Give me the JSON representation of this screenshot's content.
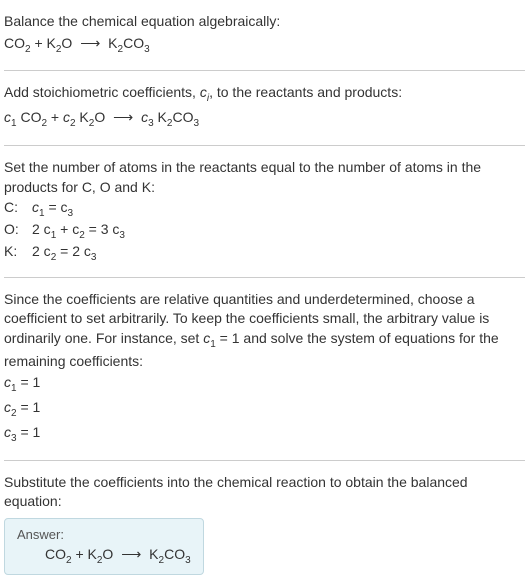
{
  "chart_data": {
    "type": "table",
    "reactants": [
      {
        "formula": "CO2",
        "coefficient": 1
      },
      {
        "formula": "K2O",
        "coefficient": 1
      }
    ],
    "products": [
      {
        "formula": "K2CO3",
        "coefficient": 1
      }
    ],
    "atom_balance": [
      {
        "element": "C",
        "equation": "c1 = c3"
      },
      {
        "element": "O",
        "equation": "2c1 + c2 = 3c3"
      },
      {
        "element": "K",
        "equation": "2c2 = 2c3"
      }
    ],
    "solution": {
      "c1": 1,
      "c2": 1,
      "c3": 1
    }
  },
  "intro": {
    "title": "Balance the chemical equation algebraically:",
    "eq_r1": "CO",
    "eq_r1_sub": "2",
    "eq_plus1": " + K",
    "eq_r2_sub": "2",
    "eq_r2_tail": "O ",
    "eq_arrow": "⟶",
    "eq_p1": " K",
    "eq_p1_sub1": "2",
    "eq_p1_mid": "CO",
    "eq_p1_sub2": "3"
  },
  "step1": {
    "text_a": "Add stoichiometric coefficients, ",
    "ci": "c",
    "ci_sub": "i",
    "text_b": ", to the reactants and products:",
    "c1": "c",
    "c1_sub": "1",
    "sp1": " CO",
    "sp1_sub": "2",
    "plus": " + ",
    "c2": "c",
    "c2_sub": "2",
    "sp2": " K",
    "sp2_sub": "2",
    "sp2_tail": "O ",
    "arrow": "⟶",
    "sp_arrow_after": " ",
    "c3": "c",
    "c3_sub": "3",
    "sp3": " K",
    "sp3_sub1": "2",
    "sp3_mid": "CO",
    "sp3_sub2": "3"
  },
  "step2": {
    "text": "Set the number of atoms in the reactants equal to the number of atoms in the products for C, O and K:",
    "rows": [
      {
        "label": "C:",
        "pre": "c",
        "sub1": "1",
        "mid": " = c",
        "sub2": "3",
        "tail": ""
      },
      {
        "label": "O:",
        "pre": "2 c",
        "sub1": "1",
        "mid": " + c",
        "sub2": "2",
        "mid2": " = 3 c",
        "sub3": "3"
      },
      {
        "label": "K:",
        "pre": "2 c",
        "sub1": "2",
        "mid": " = 2 c",
        "sub2": "3",
        "tail": ""
      }
    ]
  },
  "step3": {
    "text_a": "Since the coefficients are relative quantities and underdetermined, choose a coefficient to set arbitrarily. To keep the coefficients small, the arbitrary value is ordinarily one. For instance, set ",
    "cvar": "c",
    "cvar_sub": "1",
    "text_b": " = 1 and solve the system of equations for the remaining coefficients:",
    "lines": [
      {
        "var": "c",
        "sub": "1",
        "val": " = 1"
      },
      {
        "var": "c",
        "sub": "2",
        "val": " = 1"
      },
      {
        "var": "c",
        "sub": "3",
        "val": " = 1"
      }
    ]
  },
  "step4": {
    "text": "Substitute the coefficients into the chemical reaction to obtain the balanced equation:"
  },
  "answer": {
    "label": "Answer:",
    "eq_r1": "CO",
    "eq_r1_sub": "2",
    "eq_plus1": " + K",
    "eq_r2_sub": "2",
    "eq_r2_tail": "O ",
    "eq_arrow": "⟶",
    "eq_p1": " K",
    "eq_p1_sub1": "2",
    "eq_p1_mid": "CO",
    "eq_p1_sub2": "3"
  }
}
